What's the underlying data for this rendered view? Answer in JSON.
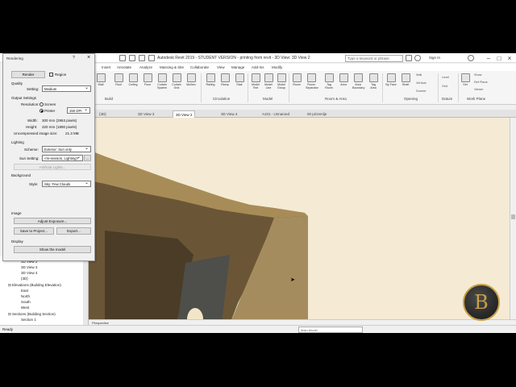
{
  "window": {
    "title": "Autodesk Revit 2019 - STUDENT VERSION - printing from revit - 3D View: 3D View 2",
    "search_placeholder": "Type a keyword or phrase",
    "sign_in": "Sign In"
  },
  "menu": [
    "Insert",
    "Annotate",
    "Analyze",
    "Massing & Site",
    "Collaborate",
    "View",
    "Manage",
    "Add-Ins",
    "Modify"
  ],
  "ribbon": {
    "buttons": [
      "Wall",
      "Roof",
      "Ceiling",
      "Floor",
      "Curtain System",
      "Curtain Grid",
      "Mullion",
      "Railing",
      "Ramp",
      "Stair",
      "Model Text",
      "Model Line",
      "Model Group",
      "Room",
      "Room Separator",
      "Tag Room",
      "Area",
      "Area Boundary",
      "Tag Area",
      "By Face",
      "Shaft",
      "Wall",
      "Vertical",
      "Dormer",
      "Level",
      "Grid",
      "Set",
      "Show",
      "Ref Plane",
      "Viewer"
    ],
    "panels": [
      "Build",
      "Circulation",
      "Model",
      "Room & Area",
      "Opening",
      "Datum",
      "Work Plane"
    ]
  },
  "tabs": [
    "{3D}",
    "3D View 3",
    "3D View 2",
    "3D View 4",
    "A101 - Unnamed",
    "00 prizemlje"
  ],
  "dialog": {
    "title": "Rendering",
    "render_button": "Render",
    "region_label": "Region",
    "quality_header": "Quality",
    "setting_label": "Setting:",
    "setting_value": "Medium",
    "output_header": "Output Settings",
    "resolution_label": "Resolution:",
    "screen_label": "Screen",
    "printer_label": "Printer",
    "dpi_value": "150 DPI",
    "width_label": "Width:",
    "width_value": "300 mm (2953 pixels)",
    "height_label": "Height:",
    "height_value": "320 mm (1890 pixels)",
    "uncompressed_label": "Uncompressed image size:",
    "uncompressed_value": "21.3 MB",
    "lighting_header": "Lighting",
    "scheme_label": "Scheme:",
    "scheme_value": "Exterior: Sun only",
    "sun_label": "Sun Setting:",
    "sun_value": "<In-session, Lighting>",
    "artificial_button": "Artificial Lights...",
    "background_header": "Background",
    "style_label": "Style:",
    "style_value": "Sky: Few Clouds",
    "image_header": "Image",
    "adjust_button": "Adjust Exposure...",
    "save_button": "Save to Project...",
    "export_button": "Export...",
    "display_header": "Display",
    "show_model_button": "Show the model"
  },
  "browser": {
    "items": [
      "3D View 2",
      "3D View 3",
      "3D View 4",
      "{3D}",
      "Elevations (Building Elevation)",
      "East",
      "North",
      "South",
      "West",
      "Sections (Building Section)",
      "Section 1"
    ]
  },
  "view_bar": {
    "label": "Perspective"
  },
  "status": {
    "ready": "Ready",
    "model": "Main Model"
  },
  "watermark": {
    "letter": "B"
  }
}
